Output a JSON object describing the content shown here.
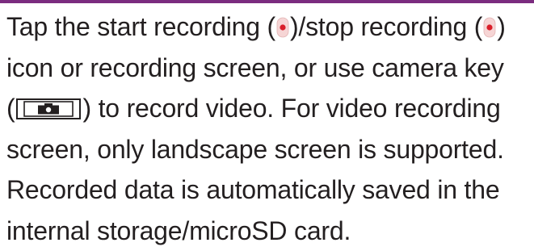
{
  "colors": {
    "rule": "#7b2c7f",
    "text": "#231f20",
    "record_icon_fill": "#f6d5d5",
    "record_icon_dot": "#d91f2a"
  },
  "icons": [
    "start-recording-icon",
    "stop-recording-icon",
    "camera-key-icon"
  ],
  "paragraph": {
    "l1_a": "Tap the start recording (",
    "l1_b": ")/stop recording (",
    "l1_c": ")",
    "l2": "icon or recording screen, or use camera key",
    "l3_a": "(",
    "l3_b": ") to record video. For video recording",
    "l4": "screen, only landscape screen is supported.",
    "l5": "Recorded data is automatically saved in the",
    "l6": "internal storage/microSD card."
  }
}
